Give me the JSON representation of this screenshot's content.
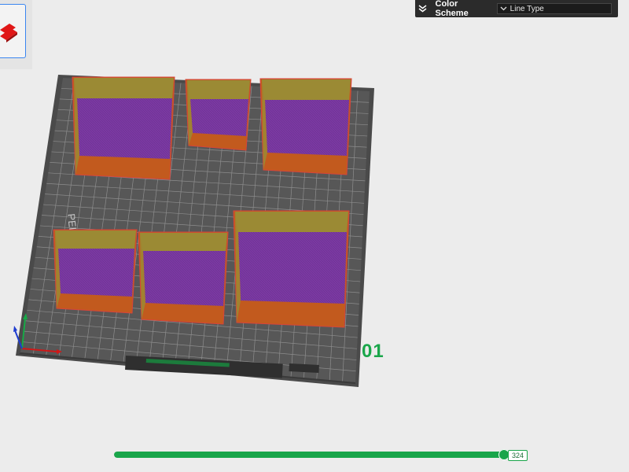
{
  "toolbar": {
    "tool_icon": "part-layers-icon"
  },
  "legend": {
    "title": "Color Scheme",
    "selected": "Line Type",
    "collapse_icon": "double-chevron-down-icon",
    "dropdown_icon": "chevron-down-icon"
  },
  "plate": {
    "label": "PEI Plate",
    "number": "01"
  },
  "colors": {
    "plate": "#565656",
    "grid": "#8a8a8a",
    "top_surface": "#7c3aa3",
    "inner_wall": "#9b8a34",
    "outer_wall": "#c25a1e",
    "accent": "#19a54a"
  },
  "layer_slider": {
    "value": 324,
    "label": "324",
    "fraction": 1.0
  }
}
